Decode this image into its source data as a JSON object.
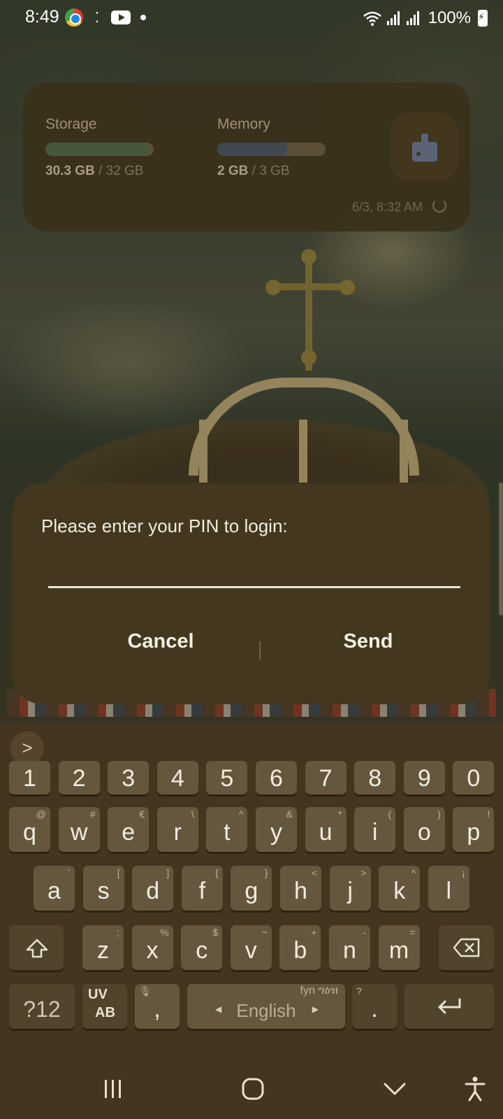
{
  "status_bar": {
    "time": "8:49",
    "battery": "100%"
  },
  "device_care_widget": {
    "storage": {
      "label": "Storage",
      "used": "30.3 GB",
      "total": "/ 32 GB",
      "fraction": 0.947,
      "bar_color": "#46583c"
    },
    "memory": {
      "label": "Memory",
      "used": "2 GB",
      "total": "/ 3 GB",
      "fraction": 0.65,
      "bar_color": "#3f4a50"
    },
    "last_checked": "6/3, 8:32 AM",
    "clean_icon": "broom-icon",
    "refresh_icon": "refresh-icon"
  },
  "dialog": {
    "message": "Please enter your PIN to login:",
    "pin_value": "",
    "cancel_label": "Cancel",
    "send_label": "Send"
  },
  "keyboard": {
    "toolbar_expand": ">",
    "number_row": [
      "1",
      "2",
      "3",
      "4",
      "5",
      "6",
      "7",
      "8",
      "9",
      "0"
    ],
    "row1": [
      {
        "k": "q",
        "s": "@"
      },
      {
        "k": "w",
        "s": "#"
      },
      {
        "k": "e",
        "s": "€"
      },
      {
        "k": "r",
        "s": "\\"
      },
      {
        "k": "t",
        "s": "^"
      },
      {
        "k": "y",
        "s": "&"
      },
      {
        "k": "u",
        "s": "*"
      },
      {
        "k": "i",
        "s": "("
      },
      {
        "k": "o",
        "s": ")"
      },
      {
        "k": "p",
        "s": "!"
      }
    ],
    "row2": [
      {
        "k": "a",
        "s": "`"
      },
      {
        "k": "s",
        "s": "["
      },
      {
        "k": "d",
        "s": "]"
      },
      {
        "k": "f",
        "s": "{"
      },
      {
        "k": "g",
        "s": "}"
      },
      {
        "k": "h",
        "s": "<"
      },
      {
        "k": "j",
        "s": ">"
      },
      {
        "k": "k",
        "s": "^"
      },
      {
        "k": "l",
        "s": "¡"
      }
    ],
    "row3": [
      {
        "k": "z",
        "s": ";"
      },
      {
        "k": "x",
        "s": "%"
      },
      {
        "k": "c",
        "s": "$"
      },
      {
        "k": "v",
        "s": "~"
      },
      {
        "k": "b",
        "s": "+"
      },
      {
        "k": "n",
        "s": "-"
      },
      {
        "k": "m",
        "s": "="
      }
    ],
    "symbols_label": "?12",
    "lang_switch_top": "UV",
    "lang_switch_bottom": "AB",
    "comma": ",",
    "space_label": "English",
    "space_hint": "fyn ግዕዝ",
    "period": ".",
    "period_hint": "?"
  },
  "nav_bar": {
    "recents_icon": "recents-icon",
    "home_icon": "home-icon",
    "hide_keyboard_icon": "chevron-down-icon",
    "accessibility_icon": "accessibility-icon"
  }
}
